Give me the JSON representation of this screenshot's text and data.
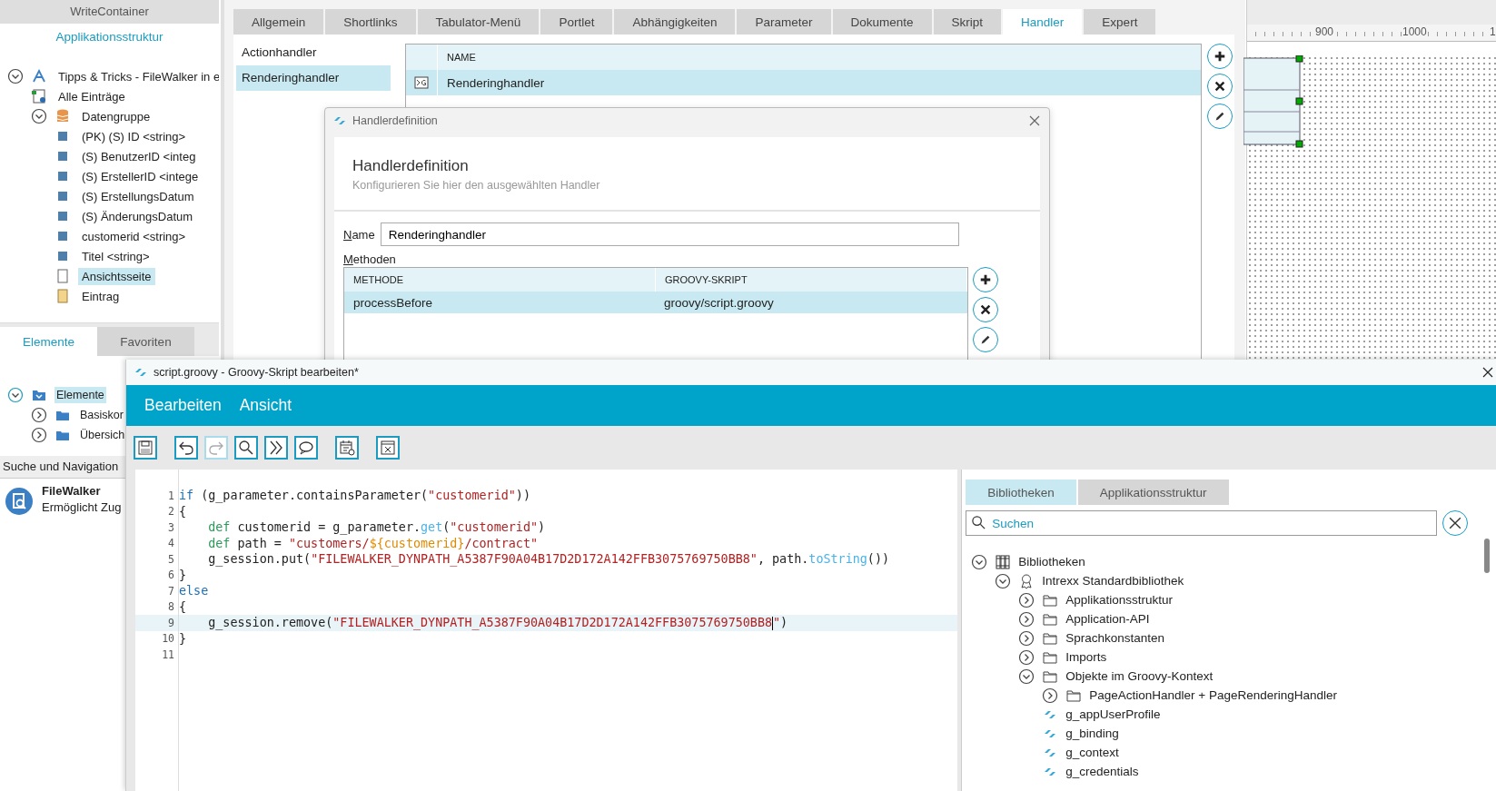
{
  "structure_panel": {
    "title": "WriteContainer",
    "heading": "Applikationsstruktur",
    "tree": [
      {
        "label": "Tipps & Tricks - FileWalker in e",
        "kind": "app",
        "selected": false,
        "expanded": true,
        "children": [
          {
            "label": "Alle Einträge",
            "kind": "view",
            "selected": false
          },
          {
            "label": "Datengruppe",
            "kind": "database",
            "selected": false,
            "expanded": true,
            "children": [
              {
                "label": "(PK) (S) ID <string>",
                "kind": "field",
                "selected": false
              },
              {
                "label": "(S) BenutzerID <integ",
                "kind": "field",
                "selected": false
              },
              {
                "label": "(S) ErstellerID <intege",
                "kind": "field",
                "selected": false
              },
              {
                "label": "(S) ErstellungsDatum",
                "kind": "field",
                "selected": false
              },
              {
                "label": "(S) ÄnderungsDatum",
                "kind": "field",
                "selected": false
              },
              {
                "label": "customerid <string>",
                "kind": "field",
                "selected": false
              },
              {
                "label": "Titel <string>",
                "kind": "field",
                "selected": false
              },
              {
                "label": "Ansichtsseite",
                "kind": "page",
                "selected": true
              },
              {
                "label": "Eintrag",
                "kind": "entry",
                "selected": false
              }
            ]
          }
        ]
      }
    ]
  },
  "elements_panel": {
    "tabs": [
      {
        "label": "Elemente",
        "selected": true
      },
      {
        "label": "Favoriten",
        "selected": false
      }
    ],
    "tree": [
      {
        "label": "Elemente",
        "kind": "tray",
        "selected": true,
        "expanded": true,
        "children": [
          {
            "label": "Basiskor",
            "kind": "folder",
            "selected": false,
            "expanded": false
          },
          {
            "label": "Übersich",
            "kind": "folder",
            "selected": false,
            "expanded": false
          }
        ]
      }
    ]
  },
  "search_navigation": {
    "title": "Suche und Navigation",
    "items": [
      {
        "title": "FileWalker",
        "description": "Ermöglicht Zug"
      }
    ]
  },
  "properties": {
    "tabs": [
      {
        "label": "Allgemein",
        "selected": false
      },
      {
        "label": "Shortlinks",
        "selected": false
      },
      {
        "label": "Tabulator-Menü",
        "selected": false
      },
      {
        "label": "Portlet",
        "selected": false
      },
      {
        "label": "Abhängigkeiten",
        "selected": false
      },
      {
        "label": "Parameter",
        "selected": false
      },
      {
        "label": "Dokumente",
        "selected": false
      },
      {
        "label": "Skript",
        "selected": false
      },
      {
        "label": "Handler",
        "selected": true
      },
      {
        "label": "Expert",
        "selected": false
      }
    ],
    "handler_types": [
      {
        "label": "Actionhandler",
        "selected": false
      },
      {
        "label": "Renderinghandler",
        "selected": true
      }
    ],
    "table": {
      "columns": [
        "NAME"
      ],
      "rows": [
        {
          "name": "Renderinghandler",
          "selected": true
        }
      ]
    }
  },
  "canvas": {
    "ruler": [
      "900",
      "1000",
      "1"
    ]
  },
  "dialog": {
    "title": "Handlerdefinition",
    "heading": "Handlerdefinition",
    "subtitle": "Konfigurieren Sie hier den ausgewählten Handler",
    "name_label": "Name",
    "name_value": "Renderinghandler",
    "methods_label": "Methoden",
    "table": {
      "columns": [
        "METHODE",
        "GROOVY-SKRIPT"
      ],
      "rows": [
        {
          "method": "processBefore",
          "script": "groovy/script.groovy",
          "selected": true
        }
      ]
    }
  },
  "editor": {
    "title": "script.groovy - Groovy-Skript bearbeiten*",
    "menu": [
      "Bearbeiten",
      "Ansicht"
    ],
    "toolbar": [
      {
        "kind": "save",
        "disabled": false
      },
      {
        "kind": "undo",
        "disabled": false
      },
      {
        "kind": "redo",
        "disabled": true
      },
      {
        "kind": "search",
        "disabled": false
      },
      {
        "kind": "forward",
        "disabled": false
      },
      {
        "kind": "comment",
        "disabled": false
      },
      {
        "kind": "calendar",
        "disabled": false
      },
      {
        "kind": "close",
        "disabled": false
      }
    ],
    "code": [
      {
        "number": "1",
        "selected": false,
        "tokens": [
          {
            "kind": "keyword",
            "text": "if"
          },
          {
            "kind": "plain",
            "text": " (g_parameter.containsParameter("
          },
          {
            "kind": "string",
            "text": "\"customerid\""
          },
          {
            "kind": "plain",
            "text": "))"
          }
        ]
      },
      {
        "number": "2",
        "selected": false,
        "tokens": [
          {
            "kind": "plain",
            "text": "{"
          }
        ]
      },
      {
        "number": "3",
        "selected": false,
        "tokens": [
          {
            "kind": "def",
            "text": "    def"
          },
          {
            "kind": "plain",
            "text": " customerid = g_parameter."
          },
          {
            "kind": "method",
            "text": "get"
          },
          {
            "kind": "plain",
            "text": "("
          },
          {
            "kind": "string",
            "text": "\"customerid\""
          },
          {
            "kind": "plain",
            "text": ")"
          }
        ]
      },
      {
        "number": "4",
        "selected": false,
        "tokens": [
          {
            "kind": "def",
            "text": "    def"
          },
          {
            "kind": "plain",
            "text": " path = "
          },
          {
            "kind": "string",
            "text": "\"customers/"
          },
          {
            "kind": "interp",
            "text": "${customerid}"
          },
          {
            "kind": "string",
            "text": "/contract\""
          }
        ]
      },
      {
        "number": "5",
        "selected": false,
        "tokens": [
          {
            "kind": "plain",
            "text": "    g_session.put("
          },
          {
            "kind": "string",
            "text": "\"FILEWALKER_DYNPATH_A5387F90A04B17D2D172A142FFB3075769750BB8\""
          },
          {
            "kind": "plain",
            "text": ", path."
          },
          {
            "kind": "method",
            "text": "toString"
          },
          {
            "kind": "plain",
            "text": "())"
          }
        ]
      },
      {
        "number": "6",
        "selected": false,
        "tokens": [
          {
            "kind": "plain",
            "text": "}"
          }
        ]
      },
      {
        "number": "7",
        "selected": false,
        "tokens": [
          {
            "kind": "keyword",
            "text": "else"
          }
        ]
      },
      {
        "number": "8",
        "selected": false,
        "tokens": [
          {
            "kind": "plain",
            "text": "{"
          }
        ]
      },
      {
        "number": "9",
        "selected": true,
        "tokens": [
          {
            "kind": "plain",
            "text": "    g_session.remove("
          },
          {
            "kind": "string",
            "text": "\"FILEWALKER_DYNPATH_A5387F90A04B17D2D172A142FFB3075769750BB8",
            "caret": true
          },
          {
            "kind": "string",
            "text": "\""
          },
          {
            "kind": "plain",
            "text": ")"
          }
        ]
      },
      {
        "number": "10",
        "selected": false,
        "tokens": [
          {
            "kind": "plain",
            "text": "}"
          }
        ]
      },
      {
        "number": "11",
        "selected": false
      }
    ],
    "library": {
      "tabs": [
        {
          "label": "Bibliotheken",
          "selected": true
        },
        {
          "label": "Applikationsstruktur",
          "selected": false
        }
      ],
      "search": {
        "placeholder": "Suchen"
      },
      "tree": [
        {
          "label": "Bibliotheken",
          "kind": "library",
          "expanded": true,
          "children": [
            {
              "label": "Intrexx Standardbibliothek",
              "kind": "award",
              "expanded": true,
              "children": [
                {
                  "label": "Applikationsstruktur",
                  "kind": "folder",
                  "expanded": false
                },
                {
                  "label": "Application-API",
                  "kind": "folder",
                  "expanded": false
                },
                {
                  "label": "Sprachkonstanten",
                  "kind": "folder",
                  "expanded": false
                },
                {
                  "label": "Imports",
                  "kind": "folder",
                  "expanded": false
                },
                {
                  "label": "Objekte im Groovy-Kontext",
                  "kind": "folder",
                  "expanded": true,
                  "children": [
                    {
                      "label": "PageActionHandler + PageRenderingHandler",
                      "kind": "folder",
                      "expanded": false
                    },
                    {
                      "label": "g_appUserProfile",
                      "kind": "object"
                    },
                    {
                      "label": "g_binding",
                      "kind": "object"
                    },
                    {
                      "label": "g_context",
                      "kind": "object"
                    },
                    {
                      "label": "g_credentials",
                      "kind": "object"
                    }
                  ]
                }
              ]
            }
          ]
        }
      ]
    }
  }
}
